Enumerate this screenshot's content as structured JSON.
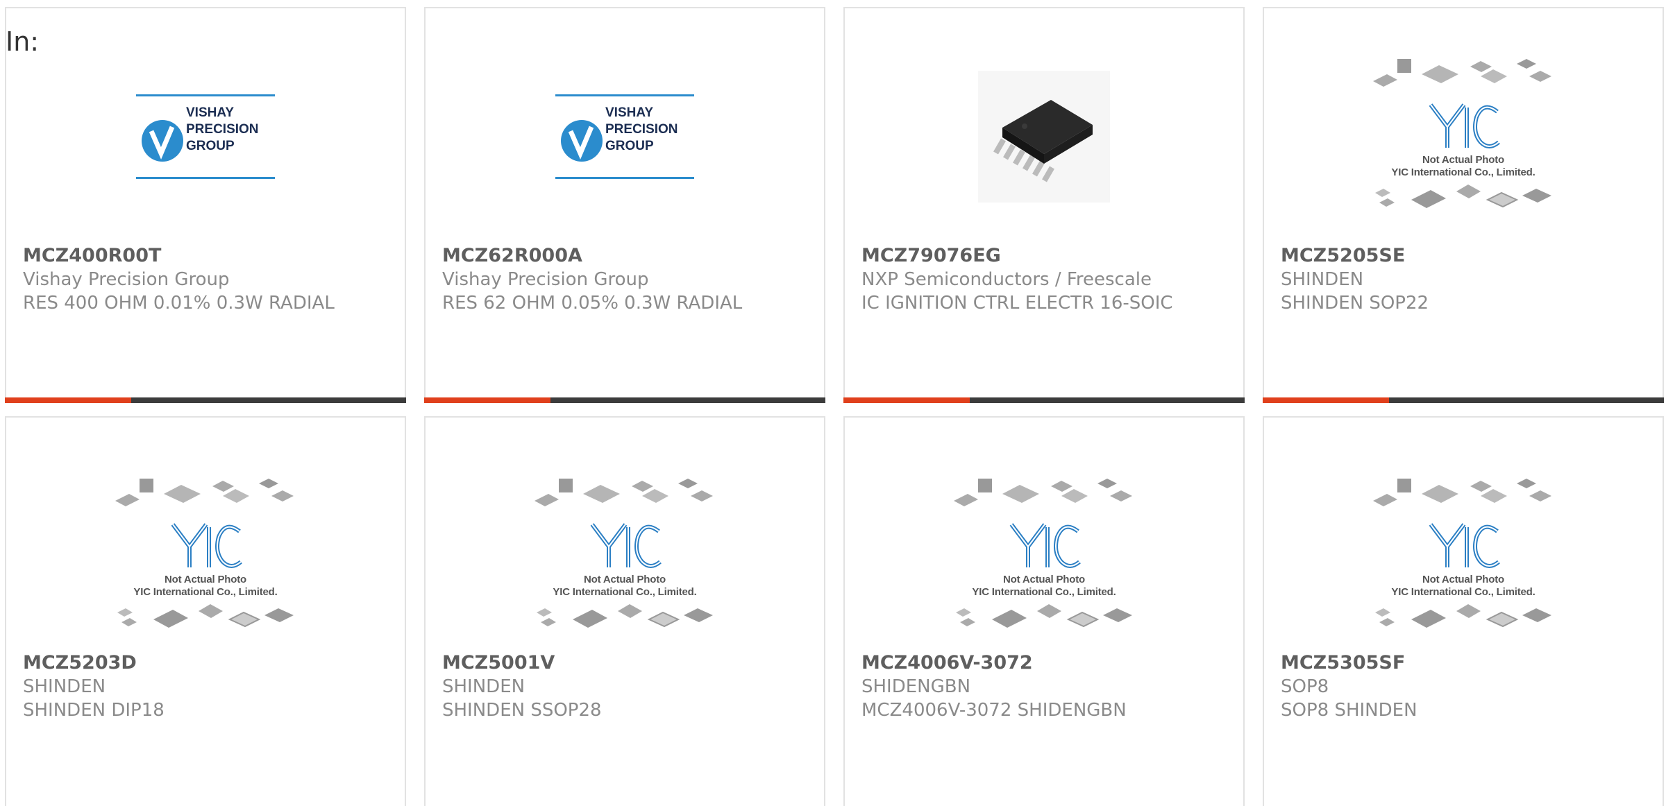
{
  "filter_label": "In:",
  "colors": {
    "accent": "#e0401c",
    "bar": "#3c3c3c",
    "logo_blue": "#2b8ccd"
  },
  "placeholder": {
    "line1": "Not Actual Photo",
    "line2": "YIC International Co., Limited."
  },
  "vishay_logo": {
    "line1": "VISHAY",
    "line2": "PRECISION",
    "line3": "GROUP"
  },
  "products": [
    {
      "part": "MCZ400R00T",
      "maker": "Vishay Precision Group",
      "desc": "RES 400 OHM 0.01% 0.3W RADIAL",
      "image": "vishay-logo"
    },
    {
      "part": "MCZ62R000A",
      "maker": "Vishay Precision Group",
      "desc": "RES 62 OHM 0.05% 0.3W RADIAL",
      "image": "vishay-logo"
    },
    {
      "part": "MCZ79076EG",
      "maker": "NXP Semiconductors / Freescale",
      "desc": "IC IGNITION CTRL ELECTR 16-SOIC",
      "image": "ic-chip"
    },
    {
      "part": "MCZ5205SE",
      "maker": "SHINDEN",
      "desc": "SHINDEN SOP22",
      "image": "yic-placeholder"
    },
    {
      "part": "MCZ5203D",
      "maker": "SHINDEN",
      "desc": "SHINDEN DIP18",
      "image": "yic-placeholder"
    },
    {
      "part": "MCZ5001V",
      "maker": "SHINDEN",
      "desc": "SHINDEN SSOP28",
      "image": "yic-placeholder"
    },
    {
      "part": "MCZ4006V-3072",
      "maker": "SHIDENGBN",
      "desc": "MCZ4006V-3072 SHIDENGBN",
      "image": "yic-placeholder"
    },
    {
      "part": "MCZ5305SF",
      "maker": "SOP8",
      "desc": "SOP8 SHINDEN",
      "image": "yic-placeholder"
    }
  ]
}
